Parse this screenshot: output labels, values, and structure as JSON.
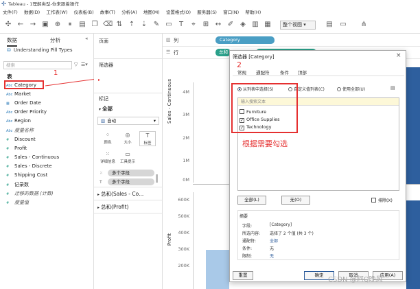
{
  "titlebar": {
    "title": "Tableau - 1理解类型-你来跟着操作"
  },
  "menubar": {
    "items": [
      "文件(F)",
      "数据(D)",
      "工作表(W)",
      "仪表板(B)",
      "故事(T)",
      "分析(A)",
      "地图(M)",
      "设置格式(O)",
      "服务器(S)",
      "窗口(N)",
      "帮助(H)"
    ]
  },
  "toolbar": {
    "view_select": "整个视图"
  },
  "datapane": {
    "tab_data": "数据",
    "tab_analysis": "分析",
    "datasource": "Understanding Pill Types",
    "search_placeholder": "搜索",
    "section_table": "表",
    "dimensions": [
      {
        "icon": "Abc",
        "label": "Category"
      },
      {
        "icon": "Abc",
        "label": "Market"
      },
      {
        "icon": "date",
        "label": "Order Date"
      },
      {
        "icon": "Abc",
        "label": "Order Priority"
      },
      {
        "icon": "Abc",
        "label": "Region"
      },
      {
        "icon": "Abc",
        "label": "度量名称"
      }
    ],
    "measures": [
      {
        "icon": "#",
        "label": "Discount"
      },
      {
        "icon": "#",
        "label": "Profit"
      },
      {
        "icon": "#",
        "label": "Sales - Continuous"
      },
      {
        "icon": "#",
        "label": "Sales - Discrete"
      },
      {
        "icon": "#",
        "label": "Shipping Cost"
      },
      {
        "icon": "#",
        "label": "记录数"
      },
      {
        "icon": "#",
        "label": "迁移的数据 (计数)"
      },
      {
        "icon": "#",
        "label": "度量值"
      }
    ]
  },
  "midpane": {
    "pages": "页面",
    "filters": "筛选器",
    "marks": "标记",
    "all": "全部",
    "mark_type": "自动",
    "buttons": [
      "颜色",
      "大小",
      "标签",
      "详细信息",
      "工具提示"
    ],
    "pills": [
      "多个字段",
      "多个字段"
    ],
    "sum_sales": "总和(Sales - Co...",
    "sum_profit": "总和(Profit)"
  },
  "view": {
    "columns_label": "列",
    "rows_label": "行",
    "col_pill": "Category",
    "row_pill": "总和",
    "y_axis_sales": "Sales - Continuous",
    "y_axis_profit": "Profit",
    "sales_ticks": [
      "4M",
      "3M",
      "2M",
      "1M",
      "0M"
    ],
    "profit_ticks": [
      "600K",
      "500K",
      "400K",
      "300K",
      "200K"
    ]
  },
  "dialog": {
    "title": "筛选器 [Category]",
    "close": "×",
    "tabs": [
      "常规",
      "通配符",
      "条件",
      "顶部"
    ],
    "radios": [
      "从列表中选择(S)",
      "自定义值列表(C)",
      "使用全部(U)"
    ],
    "input_placeholder": "输入搜索文本",
    "items": [
      {
        "label": "Furniture",
        "checked": ""
      },
      {
        "label": "Office Supplies",
        "checked": "✓"
      },
      {
        "label": "Technology",
        "checked": "✓"
      }
    ],
    "btn_all": "全部(L)",
    "btn_none": "无(O)",
    "exclude": "排除(X)",
    "summary_title": "摘要",
    "summary": [
      {
        "k": "字段:",
        "v": "[Category]"
      },
      {
        "k": "所选内容:",
        "v": "选择了 2 个值 (共 3 个)"
      },
      {
        "k": "通配符:",
        "v": "全部"
      },
      {
        "k": "条件:",
        "v": "无"
      },
      {
        "k": "限制:",
        "v": "无"
      }
    ],
    "btn_reset": "重置",
    "btn_ok": "确定",
    "btn_cancel": "取消",
    "btn_apply": "应用(A)"
  },
  "annotations": {
    "step1": "1",
    "step2": "2",
    "hint": "根据需要勾选"
  },
  "watermark": "CSDN @阿Q晚风",
  "colors": {
    "accent_red": "#e53030",
    "pill_blue": "#4a9ec4",
    "pill_green": "#2aa08a",
    "bar_blue": "#2e5f9e"
  }
}
